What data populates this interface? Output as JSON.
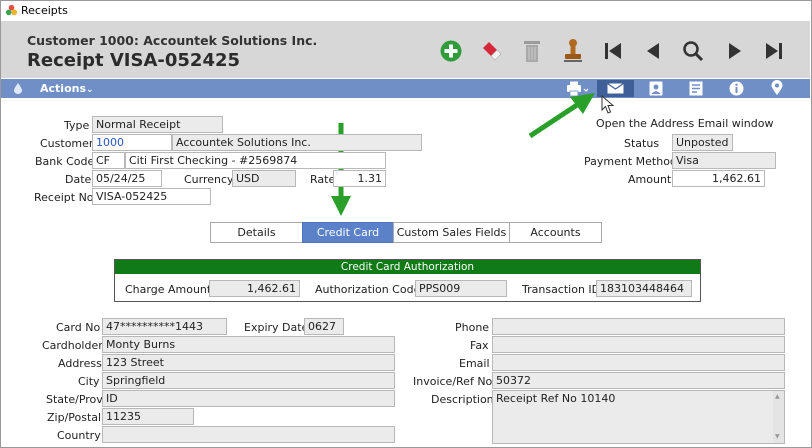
{
  "window": {
    "title": "Receipts"
  },
  "header": {
    "customer_line": "Customer 1000: Accountek Solutions Inc.",
    "receipt_line": "Receipt VISA-052425"
  },
  "toolbar": {
    "icons": [
      "add-icon",
      "eraser-icon",
      "trash-icon",
      "stamp-icon",
      "first-record-icon",
      "previous-icon",
      "search-icon",
      "next-icon",
      "last-record-icon"
    ]
  },
  "actions": {
    "label": "Actions",
    "icons": [
      "print-icon",
      "email-icon",
      "contact-icon",
      "form-icon",
      "info-icon",
      "location-icon"
    ]
  },
  "tooltip": "Open the Address Email window",
  "form": {
    "type_label": "Type",
    "type_value": "Normal Receipt",
    "customer_label": "Customer",
    "customer_code": "1000",
    "customer_name": "Accountek Solutions Inc.",
    "bank_label": "Bank Code",
    "bank_code": "CF",
    "bank_name": "Citi First Checking - #2569874",
    "date_label": "Date",
    "date_value": "05/24/25",
    "currency_label": "Currency",
    "currency_value": "USD",
    "rate_label": "Rate",
    "rate_value": "1.31",
    "receiptno_label": "Receipt No",
    "receiptno_value": "VISA-052425",
    "status_label": "Status",
    "status_value": "Unposted",
    "paymethod_label": "Payment Method",
    "paymethod_value": "Visa",
    "amount_label": "Amount",
    "amount_value": "1,462.61"
  },
  "tabs": [
    "Details",
    "Credit Card",
    "Custom Sales Fields",
    "Accounts"
  ],
  "cc_auth": {
    "title": "Credit Card Authorization",
    "charge_label": "Charge Amount",
    "charge_value": "1,462.61",
    "auth_label": "Authorization Code",
    "auth_value": "PPS009",
    "trans_label": "Transaction ID",
    "trans_value": "183103448464"
  },
  "card": {
    "cardno_label": "Card No",
    "cardno_value": "47**********1443",
    "expiry_label": "Expiry Date",
    "expiry_value": "0627",
    "holder_label": "Cardholder",
    "holder_value": "Monty Burns",
    "address_label": "Address",
    "address_value": "123 Street",
    "city_label": "City",
    "city_value": "Springfield",
    "state_label": "State/Prov",
    "state_value": "ID",
    "zip_label": "Zip/Postal",
    "zip_value": "11235",
    "country_label": "Country",
    "country_value": "",
    "phone_label": "Phone",
    "phone_value": "",
    "fax_label": "Fax",
    "fax_value": "",
    "email_label": "Email",
    "email_value": "",
    "invoice_label": "Invoice/Ref No",
    "invoice_value": "50372",
    "desc_label": "Description",
    "desc_value": "Receipt Ref No 10140"
  },
  "colors": {
    "header_bg": "#d7d7d7",
    "action_bar": "#6f8fc6",
    "selected_tab": "#5b82c9",
    "cc_header": "#0f7a16",
    "arrow": "#2aa02a",
    "link": "#2a56c6"
  }
}
